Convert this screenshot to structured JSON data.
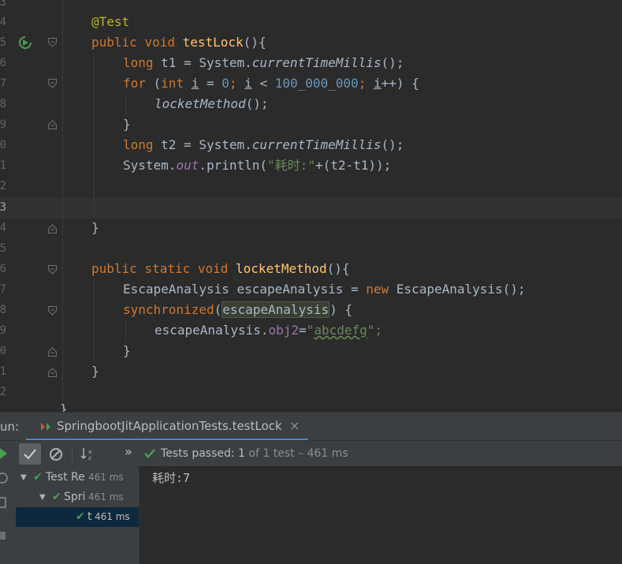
{
  "editor": {
    "line_numbers": [
      "3",
      "4",
      "5",
      "6",
      "7",
      "8",
      "9",
      "0",
      "1",
      "2",
      "3",
      "4",
      "5",
      "6",
      "7",
      "8",
      "9",
      "0",
      "1",
      "2"
    ],
    "code": {
      "annotation": "@Test",
      "method1_sig_kw": "public void",
      "method1_name": "testLock",
      "method1_sig_rest": "(){",
      "t1_kw": "long",
      "t1_rest": " t1 = System.",
      "t1_call": "currentTimeMillis",
      "t1_tail": "();",
      "for_kw": "for",
      "for_open": " (",
      "for_int": "int",
      "for_i": "i",
      "for_eq": " = ",
      "for_zero": "0",
      "for_semi": "; ",
      "for_i2": "i",
      "for_lt": " < ",
      "for_limit": "100_000_000",
      "for_semi2": "; ",
      "for_i3": "i",
      "for_inc": "++) {",
      "call_locket": "locketMethod",
      "call_locket_tail": "();",
      "brace_close": "}",
      "t2_kw": "long",
      "t2_rest": " t2 = System.",
      "t2_call": "currentTimeMillis",
      "t2_tail": "();",
      "print_a": "System.",
      "print_out": "out",
      "print_b": ".println(",
      "print_str": "\"耗时:\"",
      "print_c": "+(t2-t1));",
      "method2_kw": "public static void",
      "method2_name": "locketMethod",
      "method2_rest": "(){",
      "ea_type": "EscapeAnalysis escapeAnalysis = ",
      "ea_new": "new",
      "ea_rest": " EscapeAnalysis();",
      "sync_kw": "synchronized",
      "sync_open": "(",
      "sync_var": "escapeAnalysis",
      "sync_close": ") {",
      "assign_a": "escapeAnalysis.",
      "assign_field": "obj2",
      "assign_eq": "=",
      "assign_q1": "\"",
      "assign_val": "abcdefg",
      "assign_q2": "\";",
      "class_close": "}"
    }
  },
  "run_panel": {
    "label": "un:",
    "tab_title": "SpringbootJitApplicationTests.testLock",
    "close_glyph": "×",
    "more_glyph": "»",
    "status_prefix": "Tests passed:",
    "status_count": "1",
    "status_suffix": "of 1 test – 461 ms",
    "tree": [
      {
        "label": "Test Re",
        "time": "461 ms"
      },
      {
        "label": "Spri",
        "time": "461 ms"
      },
      {
        "label": "t",
        "time": "461 ms"
      }
    ],
    "console_output": "耗时:7"
  },
  "colors": {
    "background": "#2b2b2b",
    "keyword": "#cc7832",
    "function": "#ffc66d",
    "number": "#6897bb",
    "string": "#6a8759",
    "annotation": "#bbb529",
    "passed_green": "#499c54"
  }
}
